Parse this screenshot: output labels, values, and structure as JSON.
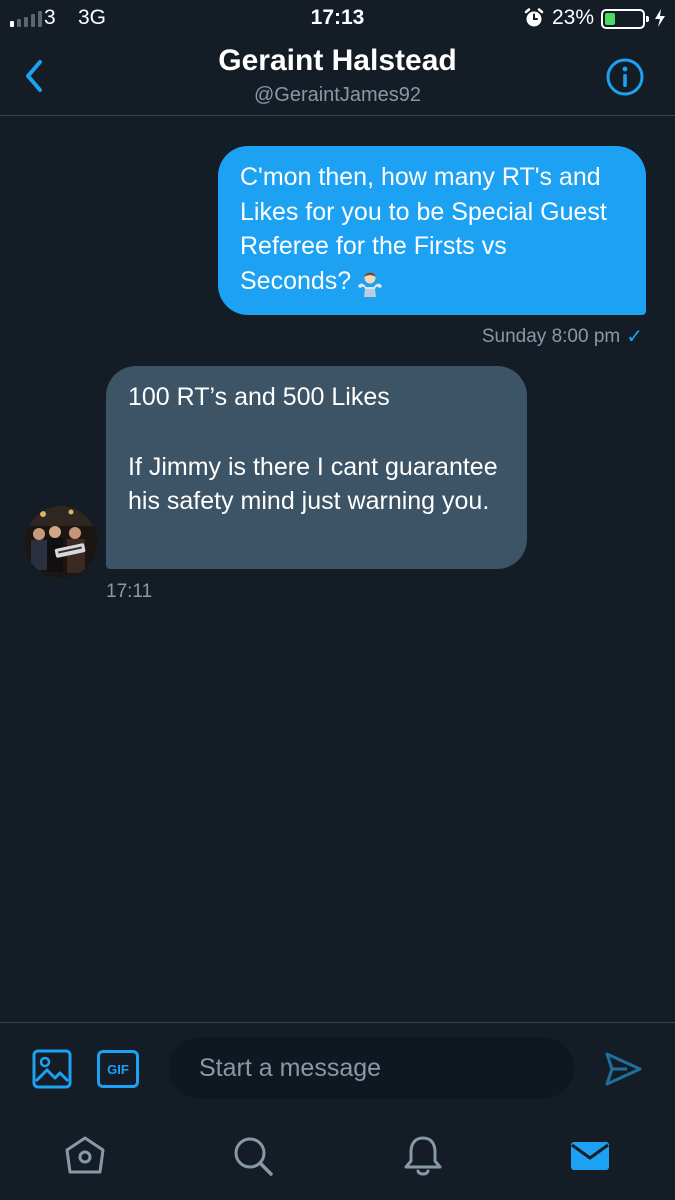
{
  "status_bar": {
    "carrier": "3",
    "network": "3G",
    "time": "17:13",
    "battery_percent": "23%",
    "signal_bars_filled": 1,
    "signal_bars_total": 5
  },
  "header": {
    "title": "Geraint Halstead",
    "handle": "@GeraintJames92"
  },
  "messages": [
    {
      "direction": "outgoing",
      "text": "C'mon then, how many RT's and Likes for you to be Special Guest Referee for the Firsts vs Seconds?",
      "emoji": "man-shrugging",
      "meta": "Sunday 8:00 pm",
      "read": true
    },
    {
      "direction": "incoming",
      "line1": "100 RT’s and 500 Likes",
      "line2": "If Jimmy is there I cant guarantee his safety mind just warning you.",
      "meta": "17:11"
    }
  ],
  "composer": {
    "placeholder": "Start a message",
    "gif_label": "GIF"
  },
  "icons": {
    "back": "chevron-left-icon",
    "info": "info-icon",
    "media": "image-icon",
    "send": "send-icon",
    "tabs": [
      "home-icon",
      "search-icon",
      "bell-icon",
      "mail-icon"
    ]
  },
  "colors": {
    "background": "#141d26",
    "accent": "#1da1f2",
    "incoming_bubble": "#3d5466",
    "secondary_text": "#8899a6",
    "battery_fill": "#4cd964"
  }
}
